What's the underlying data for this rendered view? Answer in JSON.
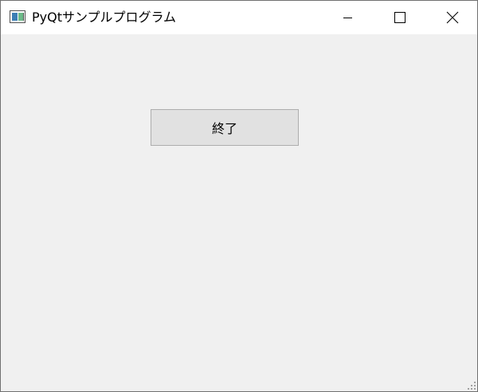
{
  "window": {
    "title": "PyQtサンプルプログラム"
  },
  "titlebar": {
    "icon": "app-window-icon",
    "buttons": [
      "minimize-icon",
      "maximize-icon",
      "close-icon"
    ]
  },
  "main": {
    "quit_button_label": "終了"
  },
  "colors": {
    "titlebar_bg": "#ffffff",
    "client_bg": "#f0f0f0",
    "button_bg": "#e1e1e1",
    "button_border": "#adadad"
  }
}
